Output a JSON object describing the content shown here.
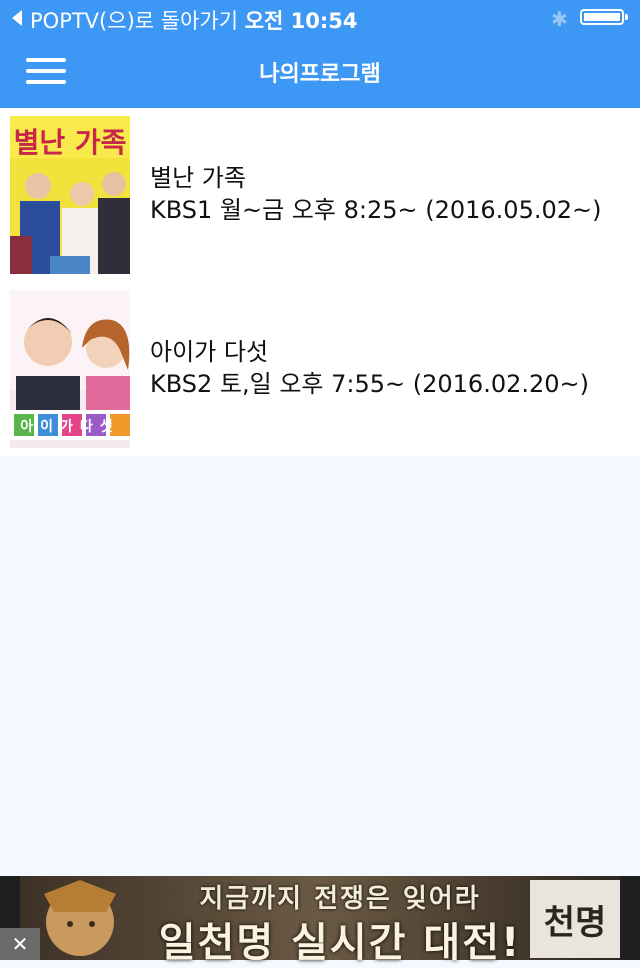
{
  "status_bar": {
    "back_app_label": "POPTV(으)로 돌아가기",
    "time": "오전 10:54",
    "bluetooth_icon": "bluetooth-icon",
    "battery_level": 1.0
  },
  "nav": {
    "menu_icon": "hamburger-menu-icon",
    "title": "나의프로그램"
  },
  "programs": [
    {
      "title": "별난 가족",
      "schedule": "KBS1 월~금 오후 8:25~ (2016.05.02~)",
      "poster_text": "별난 가족"
    },
    {
      "title": "아이가 다섯",
      "schedule": "KBS2 토,일 오후 7:55~ (2016.02.20~)",
      "poster_text": "아이가다섯"
    }
  ],
  "ad": {
    "line1": "지금까지 전쟁은 잊어라",
    "line2": "일천명 실시간 대전!",
    "logo_text": "천명",
    "close_icon": "close-icon"
  },
  "colors": {
    "accent": "#3d97f4",
    "background": "#f3f9fe",
    "list_background": "#ffffff"
  }
}
